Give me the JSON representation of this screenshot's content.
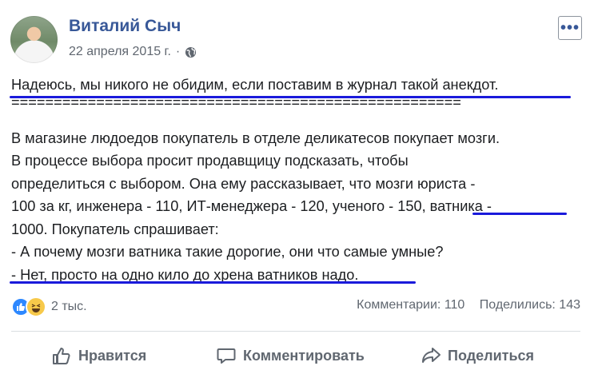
{
  "author": {
    "name": "Виталий Сыч",
    "date": "22 апреля 2015 г."
  },
  "header": {
    "separator": "·",
    "menu_label": "•••"
  },
  "post": {
    "lines": [
      "Надеюсь, мы никого не обидим, если поставим в журнал такой анекдот.",
      "=====================================================",
      "",
      "В магазине людоедов покупатель в отделе деликатесов покупает мозги.",
      "В процессе выбора просит продавщицу подсказать, чтобы",
      "определиться с выбором. Она ему рассказывает, что мозги юриста -",
      "100 за кг, инженера - 110, ИТ-менеджера - 120, ученого - 150, ватника -",
      "1000. Покупатель спрашивает:",
      "- А почему мозги ватника такие дорогие, они что самые умные?",
      "- Нет, просто на одно кило до хрена ватников надо."
    ],
    "underline_color": "#1a1adb"
  },
  "stats": {
    "reactions": "2 тыс.",
    "comments": "Комментарии: 110",
    "shares": "Поделились: 143"
  },
  "actions": {
    "like": "Нравится",
    "comment": "Комментировать",
    "share": "Поделиться"
  },
  "colors": {
    "link": "#385898",
    "muted": "#606770",
    "like_blue": "#2d88ff",
    "haha_yellow": "#f7c94a"
  }
}
